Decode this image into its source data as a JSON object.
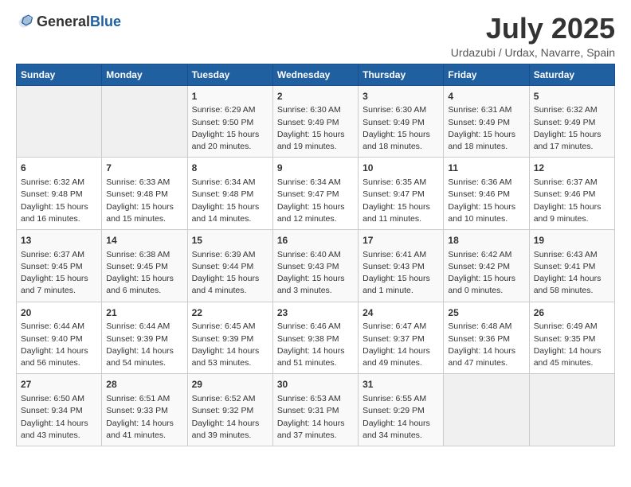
{
  "header": {
    "logo_general": "General",
    "logo_blue": "Blue",
    "main_title": "July 2025",
    "subtitle": "Urdazubi / Urdax, Navarre, Spain"
  },
  "days_of_week": [
    "Sunday",
    "Monday",
    "Tuesday",
    "Wednesday",
    "Thursday",
    "Friday",
    "Saturday"
  ],
  "weeks": [
    [
      {
        "day": "",
        "empty": true
      },
      {
        "day": "",
        "empty": true
      },
      {
        "day": "1",
        "line1": "Sunrise: 6:29 AM",
        "line2": "Sunset: 9:50 PM",
        "line3": "Daylight: 15 hours",
        "line4": "and 20 minutes."
      },
      {
        "day": "2",
        "line1": "Sunrise: 6:30 AM",
        "line2": "Sunset: 9:49 PM",
        "line3": "Daylight: 15 hours",
        "line4": "and 19 minutes."
      },
      {
        "day": "3",
        "line1": "Sunrise: 6:30 AM",
        "line2": "Sunset: 9:49 PM",
        "line3": "Daylight: 15 hours",
        "line4": "and 18 minutes."
      },
      {
        "day": "4",
        "line1": "Sunrise: 6:31 AM",
        "line2": "Sunset: 9:49 PM",
        "line3": "Daylight: 15 hours",
        "line4": "and 18 minutes."
      },
      {
        "day": "5",
        "line1": "Sunrise: 6:32 AM",
        "line2": "Sunset: 9:49 PM",
        "line3": "Daylight: 15 hours",
        "line4": "and 17 minutes."
      }
    ],
    [
      {
        "day": "6",
        "line1": "Sunrise: 6:32 AM",
        "line2": "Sunset: 9:48 PM",
        "line3": "Daylight: 15 hours",
        "line4": "and 16 minutes."
      },
      {
        "day": "7",
        "line1": "Sunrise: 6:33 AM",
        "line2": "Sunset: 9:48 PM",
        "line3": "Daylight: 15 hours",
        "line4": "and 15 minutes."
      },
      {
        "day": "8",
        "line1": "Sunrise: 6:34 AM",
        "line2": "Sunset: 9:48 PM",
        "line3": "Daylight: 15 hours",
        "line4": "and 14 minutes."
      },
      {
        "day": "9",
        "line1": "Sunrise: 6:34 AM",
        "line2": "Sunset: 9:47 PM",
        "line3": "Daylight: 15 hours",
        "line4": "and 12 minutes."
      },
      {
        "day": "10",
        "line1": "Sunrise: 6:35 AM",
        "line2": "Sunset: 9:47 PM",
        "line3": "Daylight: 15 hours",
        "line4": "and 11 minutes."
      },
      {
        "day": "11",
        "line1": "Sunrise: 6:36 AM",
        "line2": "Sunset: 9:46 PM",
        "line3": "Daylight: 15 hours",
        "line4": "and 10 minutes."
      },
      {
        "day": "12",
        "line1": "Sunrise: 6:37 AM",
        "line2": "Sunset: 9:46 PM",
        "line3": "Daylight: 15 hours",
        "line4": "and 9 minutes."
      }
    ],
    [
      {
        "day": "13",
        "line1": "Sunrise: 6:37 AM",
        "line2": "Sunset: 9:45 PM",
        "line3": "Daylight: 15 hours",
        "line4": "and 7 minutes."
      },
      {
        "day": "14",
        "line1": "Sunrise: 6:38 AM",
        "line2": "Sunset: 9:45 PM",
        "line3": "Daylight: 15 hours",
        "line4": "and 6 minutes."
      },
      {
        "day": "15",
        "line1": "Sunrise: 6:39 AM",
        "line2": "Sunset: 9:44 PM",
        "line3": "Daylight: 15 hours",
        "line4": "and 4 minutes."
      },
      {
        "day": "16",
        "line1": "Sunrise: 6:40 AM",
        "line2": "Sunset: 9:43 PM",
        "line3": "Daylight: 15 hours",
        "line4": "and 3 minutes."
      },
      {
        "day": "17",
        "line1": "Sunrise: 6:41 AM",
        "line2": "Sunset: 9:43 PM",
        "line3": "Daylight: 15 hours",
        "line4": "and 1 minute."
      },
      {
        "day": "18",
        "line1": "Sunrise: 6:42 AM",
        "line2": "Sunset: 9:42 PM",
        "line3": "Daylight: 15 hours",
        "line4": "and 0 minutes."
      },
      {
        "day": "19",
        "line1": "Sunrise: 6:43 AM",
        "line2": "Sunset: 9:41 PM",
        "line3": "Daylight: 14 hours",
        "line4": "and 58 minutes."
      }
    ],
    [
      {
        "day": "20",
        "line1": "Sunrise: 6:44 AM",
        "line2": "Sunset: 9:40 PM",
        "line3": "Daylight: 14 hours",
        "line4": "and 56 minutes."
      },
      {
        "day": "21",
        "line1": "Sunrise: 6:44 AM",
        "line2": "Sunset: 9:39 PM",
        "line3": "Daylight: 14 hours",
        "line4": "and 54 minutes."
      },
      {
        "day": "22",
        "line1": "Sunrise: 6:45 AM",
        "line2": "Sunset: 9:39 PM",
        "line3": "Daylight: 14 hours",
        "line4": "and 53 minutes."
      },
      {
        "day": "23",
        "line1": "Sunrise: 6:46 AM",
        "line2": "Sunset: 9:38 PM",
        "line3": "Daylight: 14 hours",
        "line4": "and 51 minutes."
      },
      {
        "day": "24",
        "line1": "Sunrise: 6:47 AM",
        "line2": "Sunset: 9:37 PM",
        "line3": "Daylight: 14 hours",
        "line4": "and 49 minutes."
      },
      {
        "day": "25",
        "line1": "Sunrise: 6:48 AM",
        "line2": "Sunset: 9:36 PM",
        "line3": "Daylight: 14 hours",
        "line4": "and 47 minutes."
      },
      {
        "day": "26",
        "line1": "Sunrise: 6:49 AM",
        "line2": "Sunset: 9:35 PM",
        "line3": "Daylight: 14 hours",
        "line4": "and 45 minutes."
      }
    ],
    [
      {
        "day": "27",
        "line1": "Sunrise: 6:50 AM",
        "line2": "Sunset: 9:34 PM",
        "line3": "Daylight: 14 hours",
        "line4": "and 43 minutes."
      },
      {
        "day": "28",
        "line1": "Sunrise: 6:51 AM",
        "line2": "Sunset: 9:33 PM",
        "line3": "Daylight: 14 hours",
        "line4": "and 41 minutes."
      },
      {
        "day": "29",
        "line1": "Sunrise: 6:52 AM",
        "line2": "Sunset: 9:32 PM",
        "line3": "Daylight: 14 hours",
        "line4": "and 39 minutes."
      },
      {
        "day": "30",
        "line1": "Sunrise: 6:53 AM",
        "line2": "Sunset: 9:31 PM",
        "line3": "Daylight: 14 hours",
        "line4": "and 37 minutes."
      },
      {
        "day": "31",
        "line1": "Sunrise: 6:55 AM",
        "line2": "Sunset: 9:29 PM",
        "line3": "Daylight: 14 hours",
        "line4": "and 34 minutes."
      },
      {
        "day": "",
        "empty": true
      },
      {
        "day": "",
        "empty": true
      }
    ]
  ]
}
